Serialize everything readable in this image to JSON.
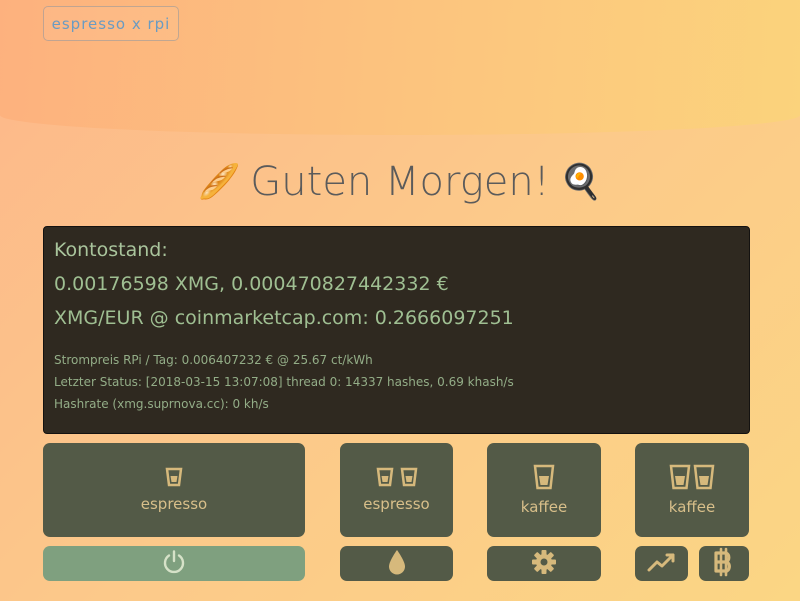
{
  "header": {
    "brand": "espresso x rpi"
  },
  "greeting": {
    "text": "Guten Morgen!",
    "left_emoji": "🥖",
    "right_emoji": "🍳"
  },
  "account": {
    "title": "Kontostand:",
    "balance": "0.00176598 XMG, 0.000470827442332 €",
    "rate": "XMG/EUR @ coinmarketcap.com: 0.2666097251",
    "power_price": "Strompreis RPi / Tag: 0.006407232 € @ 25.67 ct/kWh",
    "last_status": "Letzter Status: [2018-03-15 13:07:08] thread 0: 14337 hashes, 0.69 khash/s",
    "hashrate": "Hashrate (xmg.suprnova.cc): 0 kh/s"
  },
  "buttons": {
    "espresso_single": "espresso",
    "espresso_double": "espresso",
    "kaffee_single": "kaffee",
    "kaffee_double": "kaffee"
  },
  "icons": {
    "power": "power-icon",
    "water": "water-drop-icon",
    "settings": "gear-icon",
    "chart": "chart-line-icon",
    "bitcoin": "bitcoin-icon"
  },
  "colors": {
    "panel_bg": "#2f2920",
    "button_bg": "#535a47",
    "button_text": "#d8bf8a",
    "power_button_bg": "#7fa07f",
    "panel_text": "#a8c39a"
  }
}
